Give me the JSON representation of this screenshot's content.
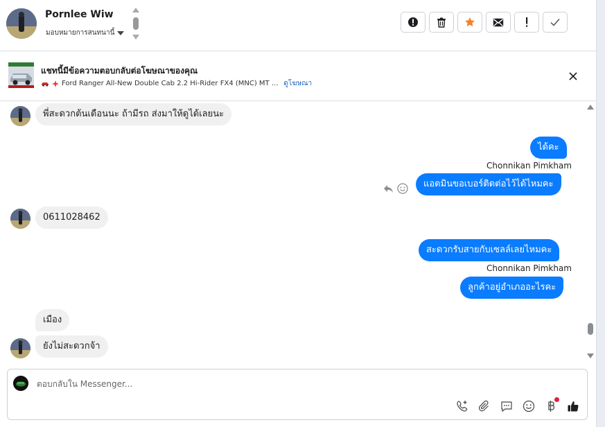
{
  "header": {
    "contact_name": "Pornlee Wiw",
    "assign_label": "มอบหมายการสนทนานี้"
  },
  "ad": {
    "title": "แชทนี้มีข้อความตอบกลับต่อโฆษณาของคุณ",
    "car_name": "Ford Ranger All-New Double Cab 2.2 Hi-Rider FX4 (MNC) MT ...",
    "link_label": "ดูโฆษณา"
  },
  "messages": [
    {
      "direction": "in",
      "text": "พี่สะดวกต้นเดือนนะ  ถ้ามีรถ ส่งมาให้ดูได้เลยนะ"
    },
    {
      "direction": "out",
      "text": "ได้คะ"
    },
    {
      "direction": "out",
      "sender": "Chonnikan Pimkham",
      "text": "แอดมินขอเบอร์ติดต่อไว้ได้ไหมคะ"
    },
    {
      "direction": "in",
      "text": "0611028462"
    },
    {
      "direction": "out",
      "text": "สะดวกรับสายกับเซลล์เลยไหมคะ"
    },
    {
      "direction": "out",
      "sender": "Chonnikan Pimkham",
      "text": "ลูกค้าอยู่อำเภออะไรคะ"
    },
    {
      "direction": "in",
      "text": "เมือง"
    },
    {
      "direction": "in",
      "text": "ยังไม่สะดวกจ้า"
    }
  ],
  "composer": {
    "placeholder": "ตอบกลับใน Messenger..."
  },
  "colors": {
    "outgoing_bubble": "#0a7cff",
    "incoming_bubble": "#f0f0f0",
    "star_accent": "#f5822a",
    "link": "#1a66c2"
  },
  "icons": {
    "actions": [
      "alert-circle-icon",
      "trash-icon",
      "star-icon",
      "mail-icon",
      "exclamation-icon",
      "check-icon"
    ],
    "composer_tools": [
      "phone-add-icon",
      "paperclip-icon",
      "saved-reply-icon",
      "emoji-icon",
      "baht-icon",
      "thumbs-up-icon"
    ]
  }
}
